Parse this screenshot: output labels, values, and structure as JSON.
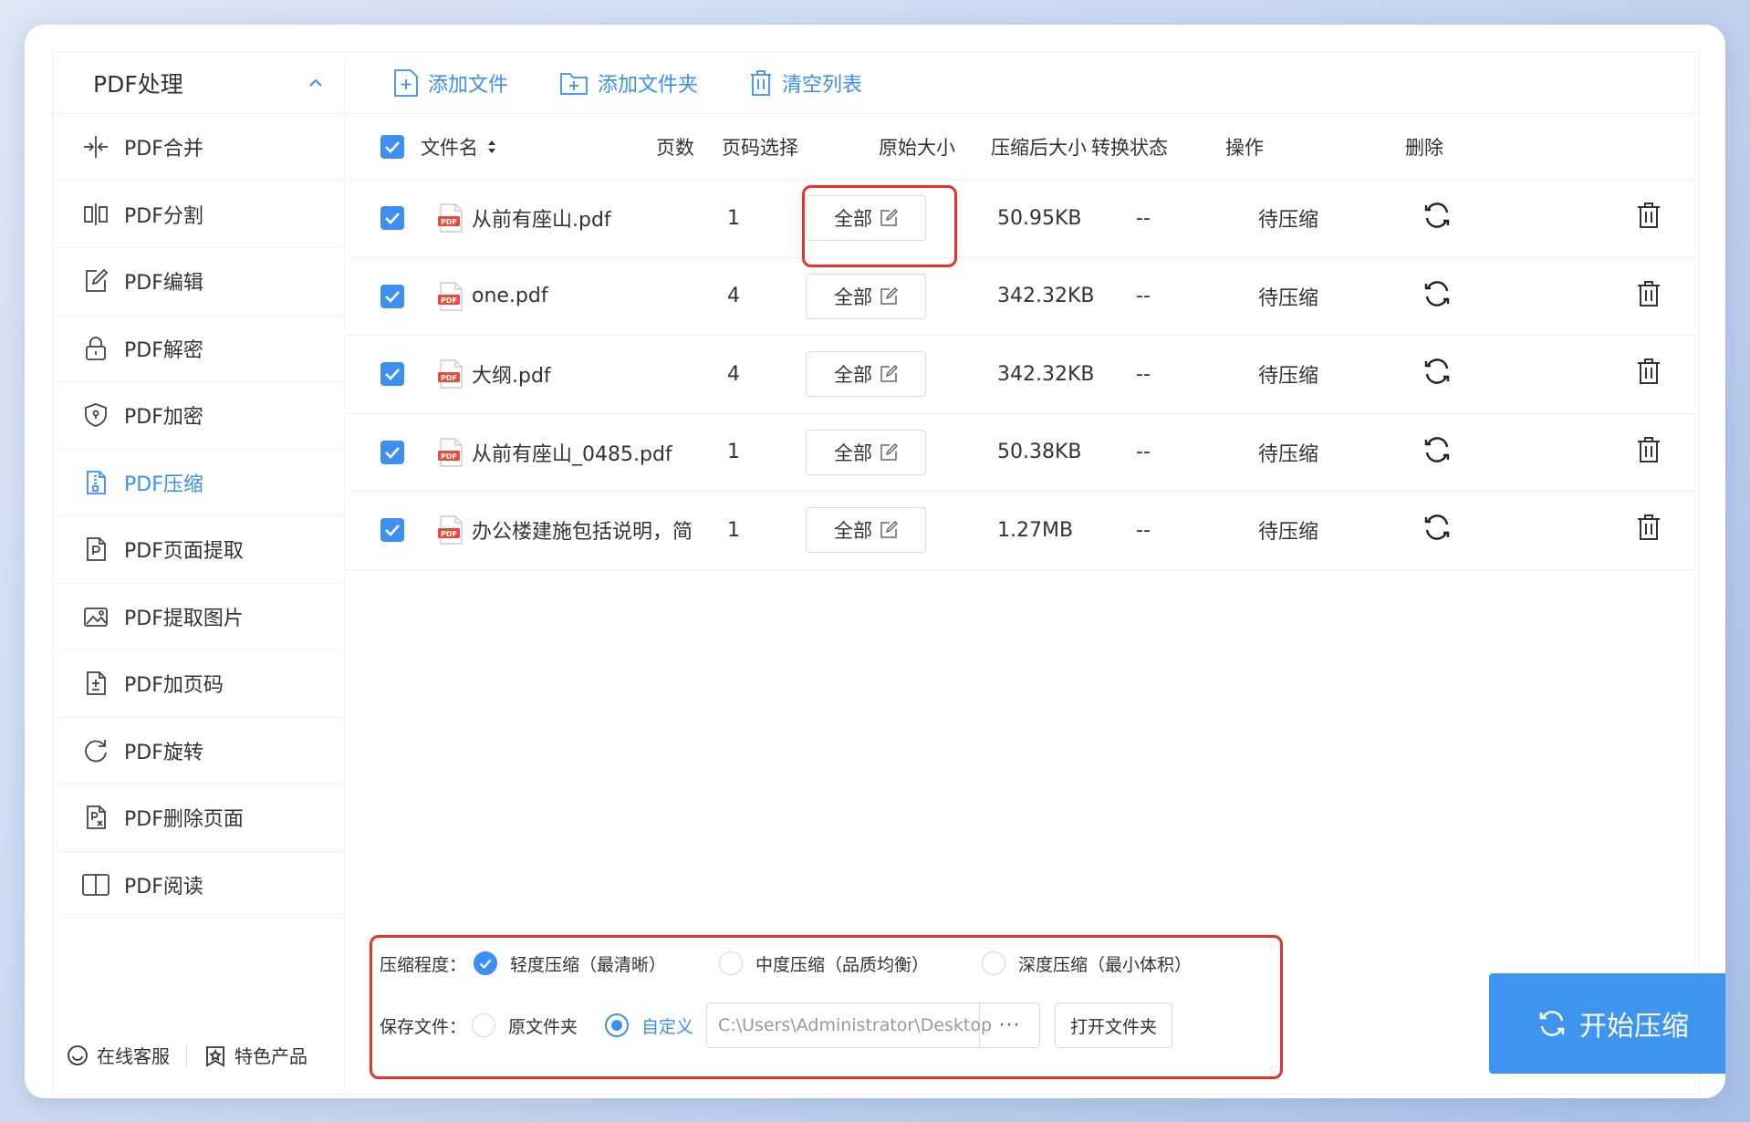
{
  "sidebar": {
    "title": "PDF处理",
    "items": [
      {
        "label": "PDF合并",
        "icon": "merge-icon"
      },
      {
        "label": "PDF分割",
        "icon": "split-icon"
      },
      {
        "label": "PDF编辑",
        "icon": "edit-icon"
      },
      {
        "label": "PDF解密",
        "icon": "unlock-icon"
      },
      {
        "label": "PDF加密",
        "icon": "shield-icon"
      },
      {
        "label": "PDF压缩",
        "icon": "compress-icon",
        "active": true
      },
      {
        "label": "PDF页面提取",
        "icon": "page-extract-icon"
      },
      {
        "label": "PDF提取图片",
        "icon": "image-extract-icon"
      },
      {
        "label": "PDF加页码",
        "icon": "page-number-icon"
      },
      {
        "label": "PDF旋转",
        "icon": "rotate-icon"
      },
      {
        "label": "PDF删除页面",
        "icon": "page-delete-icon"
      },
      {
        "label": "PDF阅读",
        "icon": "book-icon"
      }
    ],
    "footer": {
      "service": "在线客服",
      "products": "特色产品"
    }
  },
  "toolbar": {
    "add_file": "添加文件",
    "add_folder": "添加文件夹",
    "clear_list": "清空列表"
  },
  "table": {
    "headers": {
      "name": "文件名",
      "pages": "页数",
      "range": "页码选择",
      "orig_size": "原始大小",
      "after_size": "压缩后大小",
      "status": "转换状态",
      "op": "操作",
      "del": "删除"
    },
    "rows": [
      {
        "name": "从前有座山.pdf",
        "pages": "1",
        "range": "全部",
        "orig": "50.95KB",
        "after": "--",
        "status": "待压缩"
      },
      {
        "name": "one.pdf",
        "pages": "4",
        "range": "全部",
        "orig": "342.32KB",
        "after": "--",
        "status": "待压缩"
      },
      {
        "name": "大纲.pdf",
        "pages": "4",
        "range": "全部",
        "orig": "342.32KB",
        "after": "--",
        "status": "待压缩"
      },
      {
        "name": "从前有座山_0485.pdf",
        "pages": "1",
        "range": "全部",
        "orig": "50.38KB",
        "after": "--",
        "status": "待压缩"
      },
      {
        "name": "办公楼建施包括说明，简",
        "pages": "1",
        "range": "全部",
        "orig": "1.27MB",
        "after": "--",
        "status": "待压缩"
      }
    ]
  },
  "settings": {
    "level_label": "压缩程度：",
    "level_options": [
      "轻度压缩（最清晰）",
      "中度压缩（品质均衡）",
      "深度压缩（最小体积）"
    ],
    "level_selected": 0,
    "save_label": "保存文件：",
    "save_options": [
      "原文件夹",
      "自定义"
    ],
    "save_selected": 1,
    "path": "C:\\Users\\Administrator\\Desktop",
    "more": "···",
    "open_folder": "打开文件夹"
  },
  "start_button": "开始压缩",
  "colors": {
    "accent": "#3d8ff0",
    "highlight": "#e8322a",
    "pdf_red": "#e84a3c"
  }
}
